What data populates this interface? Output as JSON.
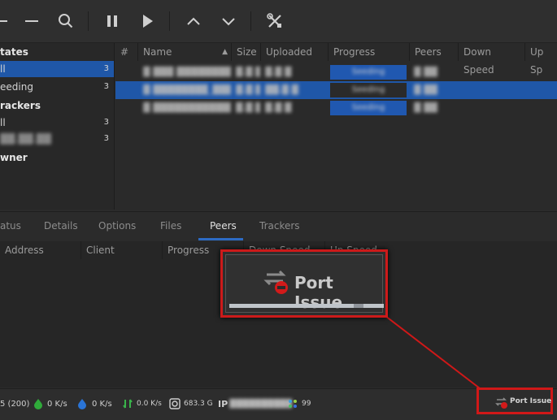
{
  "sidebar": {
    "states_header": "tates",
    "items_states": [
      {
        "label": "ll",
        "count": "3"
      },
      {
        "label": "eeding",
        "count": "3"
      }
    ],
    "trackers_header": "rackers",
    "items_trackers": [
      {
        "label": "ll",
        "count": "3"
      },
      {
        "label": "▓▓.▓▓.▓▓",
        "count": "3"
      }
    ],
    "owner_header": "wner"
  },
  "torrent_list": {
    "columns": [
      "#",
      "Name",
      "Size",
      "Uploaded",
      "Progress",
      "Peers",
      "Down Speed",
      "Up Sp"
    ],
    "rows": [
      {
        "name": "▓ ▓▓▓ ▓▓▓▓▓▓▓▓ ▓▓",
        "size": "▓.▓ ▓",
        "uploaded": "▓.▓ ▓",
        "progress": "Seeding",
        "peers": "▓ ▓▓"
      },
      {
        "name": "▓ ▓▓▓▓▓▓▓▓_▓▓▓",
        "size": "▓.▓ ▓",
        "uploaded": "▓▓.▓ ▓",
        "progress": "Seeding",
        "peers": "▓ ▓▓"
      },
      {
        "name": "▓ ▓▓▓▓▓▓▓▓▓▓▓▓ ▓▓",
        "size": "▓.▓ ▓",
        "uploaded": "▓.▓ ▓",
        "progress": "Seeding",
        "peers": "▓ ▓▓"
      }
    ]
  },
  "tabs": [
    "atus",
    "Details",
    "Options",
    "Files",
    "Peers",
    "Trackers"
  ],
  "active_tab": "Peers",
  "peers_columns": [
    "Address",
    "Client",
    "Progress",
    "Down Speed",
    "Up Speed"
  ],
  "statusbar": {
    "connections": "5 (200)",
    "down_speed": "0 K/s",
    "up_speed": "0 K/s",
    "dht": "0.0 K/s",
    "disk": "683.3 G",
    "ip_label": "IP",
    "ip_value": "▓▓▓▓▓▓▓▓▓▓",
    "dht_nodes": "99",
    "port_issue": "Port Issue"
  },
  "zoom_callout": {
    "label": "Port Issue"
  },
  "colors": {
    "selection": "#1f57a8",
    "callout_border": "#d01818"
  }
}
